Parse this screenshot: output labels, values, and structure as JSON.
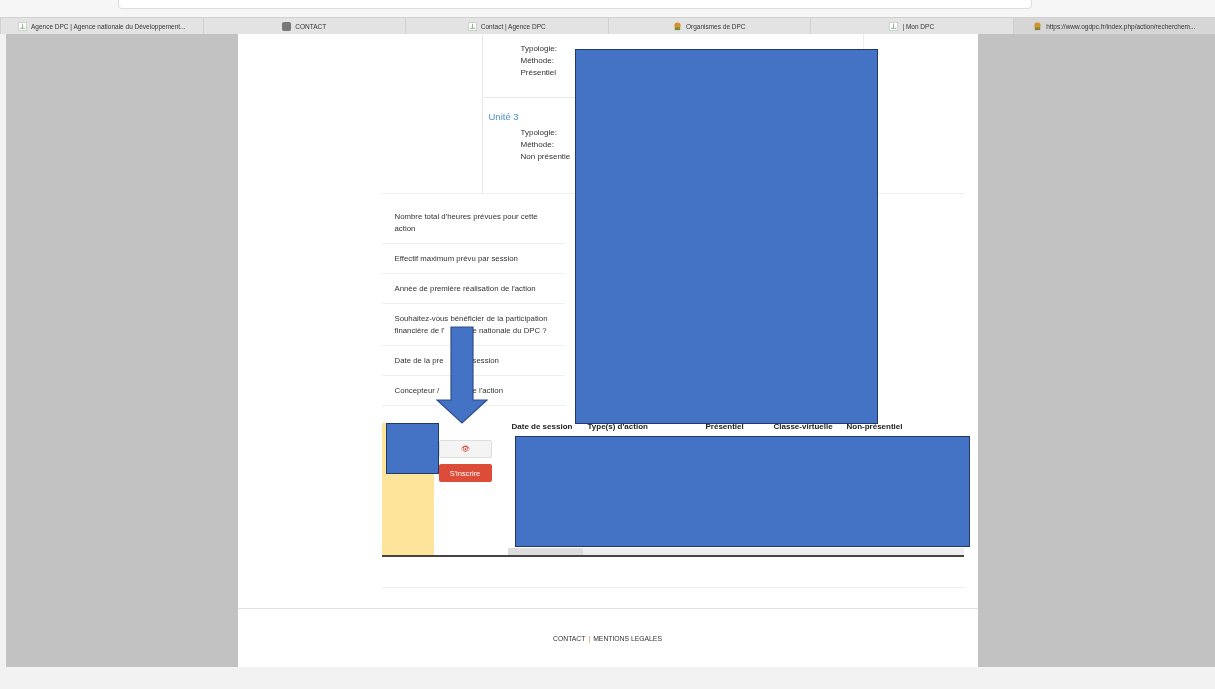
{
  "tabs": [
    {
      "label": "Agence DPC | Agence nationale du Développement...",
      "selected": false
    },
    {
      "label": "CONTACT",
      "selected": false
    },
    {
      "label": "Contact | Agence DPC",
      "selected": false
    },
    {
      "label": "Organismes de DPC",
      "selected": false
    },
    {
      "label": "| Mon DPC",
      "selected": false
    },
    {
      "label": "https://www.ogdpc.fr/index.php/action/recherchem...",
      "selected": true
    }
  ],
  "units": [
    {
      "lines": [
        "Typologie:",
        "Méthode:",
        "Présentiel"
      ]
    },
    {
      "title": "Unité 3",
      "lines": [
        "Typologie:",
        "Méthode:",
        "Non présentie"
      ]
    }
  ],
  "fields": [
    [
      [
        "Nombre total d'heures prévues pour cette action"
      ]
    ],
    [
      [
        "Effectif maximum prévu par session"
      ]
    ],
    [
      [
        "Année de première réalisation de l'action"
      ]
    ],
    [
      [
        "Souhaitez-vous bénéficier de la participation"
      ],
      [
        "financière de l'",
        "e nationale du DPC ?"
      ]
    ],
    [
      [
        "Date de la pre",
        "session"
      ]
    ],
    [
      [
        "Concepteur / ",
        "e l'action"
      ]
    ]
  ],
  "session_table": {
    "columns": [
      "Date de session",
      "Type(s) d'action",
      "Présentiel",
      "Classe-virtuelle",
      "Non-présentiel"
    ],
    "view_icon": "👁",
    "register_button": "S'inscrire"
  },
  "footer": {
    "links": [
      "CONTACT",
      "MENTIONS LEGALES"
    ],
    "separator": "|"
  }
}
